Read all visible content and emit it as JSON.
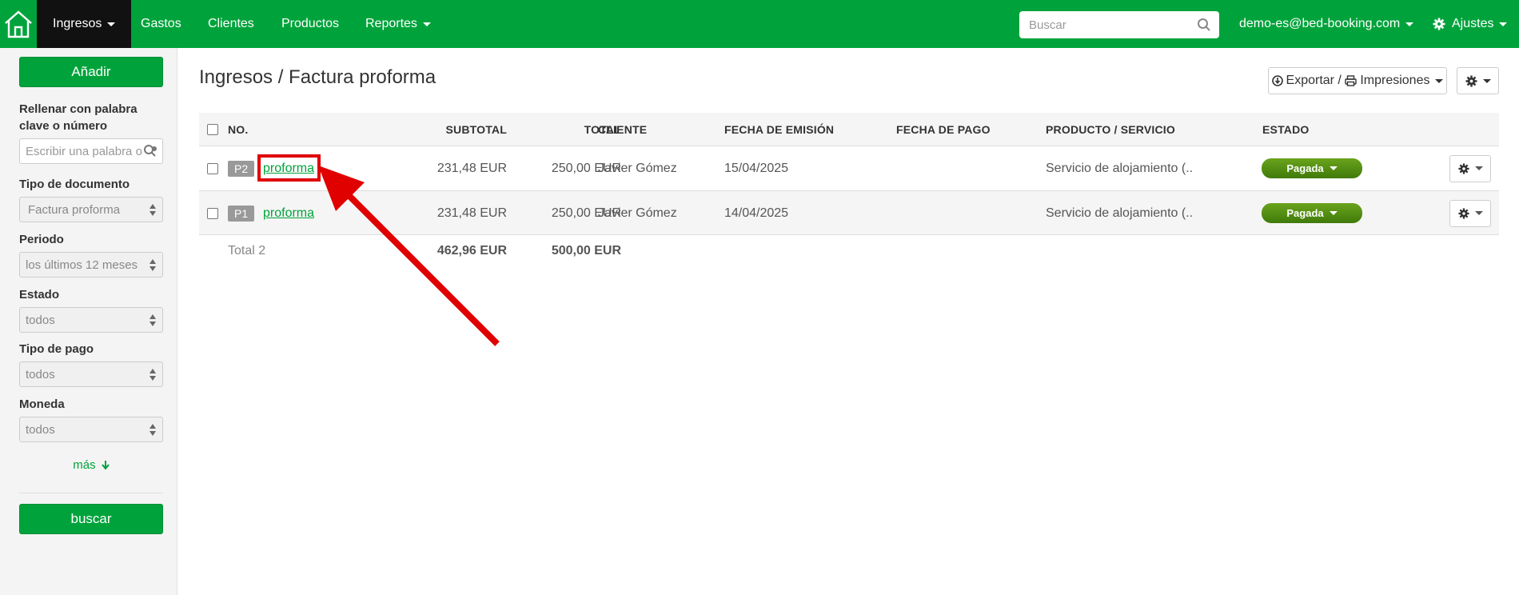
{
  "nav": {
    "items": [
      {
        "label": "Ingresos"
      },
      {
        "label": "Gastos"
      },
      {
        "label": "Clientes"
      },
      {
        "label": "Productos"
      },
      {
        "label": "Reportes"
      }
    ],
    "search_placeholder": "Buscar",
    "user": "demo-es@bed-booking.com",
    "settings": "Ajustes"
  },
  "sidebar": {
    "add_button": "Añadir",
    "keyword_label": "Rellenar con palabra clave o número",
    "keyword_placeholder": "Escribir una palabra o",
    "doc_type_label": "Tipo de documento",
    "doc_type_value": "Factura proforma",
    "period_label": "Periodo",
    "period_value": "los últimos 12 meses",
    "status_label": "Estado",
    "status_value": "todos",
    "payment_label": "Tipo de pago",
    "payment_value": "todos",
    "currency_label": "Moneda",
    "currency_value": "todos",
    "more": "más",
    "search_button": "buscar"
  },
  "main": {
    "title": "Ingresos / Factura proforma",
    "export_label": "Exportar / ",
    "print_label": "Impresiones"
  },
  "table": {
    "columns": {
      "no": "NO.",
      "subtotal": "SUBTOTAL",
      "total": "TOTAL",
      "client": "CLIENTE",
      "issue_date": "FECHA DE EMISIÓN",
      "pay_date": "FECHA DE PAGO",
      "product": "PRODUCTO / SERVICIO",
      "status": "ESTADO"
    },
    "rows": [
      {
        "tag": "P2",
        "name": "proforma",
        "subtotal": "231,48 EUR",
        "total": "250,00 EUR",
        "client": "Javier Gómez",
        "issue_date": "15/04/2025",
        "pay_date": "",
        "product": "Servicio de alojamiento (..",
        "status": "Pagada"
      },
      {
        "tag": "P1",
        "name": "proforma",
        "subtotal": "231,48 EUR",
        "total": "250,00 EUR",
        "client": "Javier Gómez",
        "issue_date": "14/04/2025",
        "pay_date": "",
        "product": "Servicio de alojamiento (..",
        "status": "Pagada"
      }
    ],
    "footer": {
      "label": "Total 2",
      "subtotal": "462,96 EUR",
      "total": "500,00 EUR"
    }
  },
  "colors": {
    "brand_green": "#00a33b",
    "annotation_red": "#e00000",
    "status_green": "#4f8a10"
  },
  "icons": [
    "home-icon",
    "search-icon",
    "gear-icon",
    "download-icon",
    "print-icon",
    "arrow-down-icon"
  ]
}
